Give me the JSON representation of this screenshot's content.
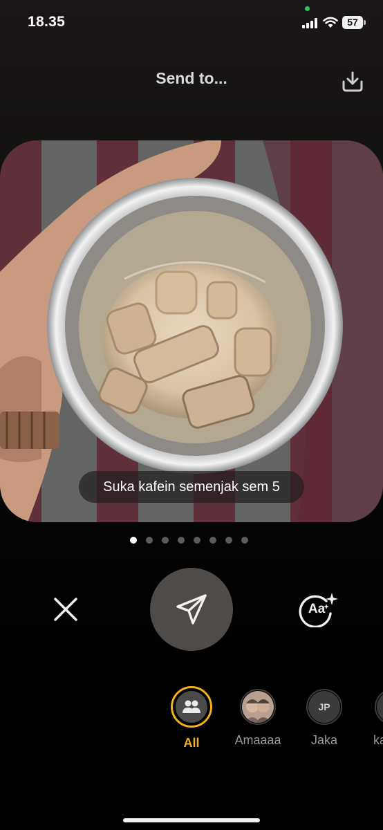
{
  "status_bar": {
    "time": "18.35",
    "battery": "57",
    "icons": [
      "signal-icon",
      "wifi-icon",
      "battery-icon"
    ]
  },
  "header": {
    "title": "Send to...",
    "download_icon": "download-icon"
  },
  "photo": {
    "caption": "Suka kafein semenjak sem 5"
  },
  "pager": {
    "count": 8,
    "active_index": 0
  },
  "actions": {
    "close_icon": "close-icon",
    "send_icon": "paper-plane-icon",
    "text_tool_label": "Aa"
  },
  "recipients": [
    {
      "label": "All",
      "selected": true,
      "icon": "people-icon"
    },
    {
      "label": "Amaaaa",
      "selected": false,
      "icon": "avatar-photo"
    },
    {
      "label": "Jaka",
      "selected": false,
      "initials": "JP"
    },
    {
      "label": "ka",
      "selected": false,
      "partial": true
    }
  ],
  "colors": {
    "accent": "#f4b019",
    "send_button": "#4f4b49",
    "background": "#0c0a0a"
  }
}
